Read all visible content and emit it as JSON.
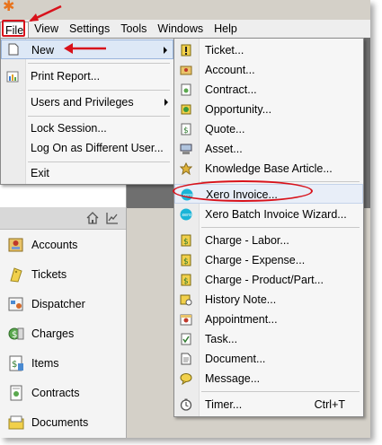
{
  "menubar": {
    "items": [
      "File",
      "View",
      "Settings",
      "Tools",
      "Windows",
      "Help"
    ]
  },
  "file_menu": {
    "items": [
      {
        "label": "New",
        "icon": "new-document-icon",
        "submenu": true
      },
      {
        "label": "Print Report...",
        "icon": "print-report-icon"
      },
      {
        "label": "Users and Privileges",
        "icon": "",
        "submenu": true
      },
      {
        "label": "Lock Session...",
        "icon": ""
      },
      {
        "label": "Log On as Different User...",
        "icon": ""
      },
      {
        "label": "Exit",
        "icon": ""
      }
    ]
  },
  "new_submenu": {
    "items": [
      {
        "label": "Ticket...",
        "icon": "ticket-icon"
      },
      {
        "label": "Account...",
        "icon": "account-icon"
      },
      {
        "label": "Contract...",
        "icon": "contract-icon"
      },
      {
        "label": "Opportunity...",
        "icon": "opportunity-icon"
      },
      {
        "label": "Quote...",
        "icon": "quote-icon"
      },
      {
        "label": "Asset...",
        "icon": "asset-icon"
      },
      {
        "label": "Knowledge Base Article...",
        "icon": "knowledge-base-icon"
      },
      {
        "label": "Xero Invoice...",
        "icon": "xero-icon"
      },
      {
        "label": "Xero Batch Invoice Wizard...",
        "icon": "xero-icon"
      },
      {
        "label": "Charge - Labor...",
        "icon": "charge-icon"
      },
      {
        "label": "Charge - Expense...",
        "icon": "charge-icon"
      },
      {
        "label": "Charge - Product/Part...",
        "icon": "charge-icon"
      },
      {
        "label": "History Note...",
        "icon": "history-note-icon"
      },
      {
        "label": "Appointment...",
        "icon": "appointment-icon"
      },
      {
        "label": "Task...",
        "icon": "task-icon"
      },
      {
        "label": "Document...",
        "icon": "document-icon"
      },
      {
        "label": "Message...",
        "icon": "message-icon"
      },
      {
        "label": "Timer...",
        "icon": "timer-icon",
        "shortcut": "Ctrl+T"
      }
    ]
  },
  "nav_panel": {
    "items": [
      {
        "label": "Accounts",
        "icon": "accounts-icon"
      },
      {
        "label": "Tickets",
        "icon": "tickets-icon"
      },
      {
        "label": "Dispatcher",
        "icon": "dispatcher-icon"
      },
      {
        "label": "Charges",
        "icon": "charges-icon"
      },
      {
        "label": "Items",
        "icon": "items-icon"
      },
      {
        "label": "Contracts",
        "icon": "contracts-icon"
      },
      {
        "label": "Documents",
        "icon": "documents-icon"
      }
    ]
  },
  "colors": {
    "annotation_red": "#d8121b",
    "selection_blue": "#dde8f6",
    "xero_blue": "#1ab4d7"
  }
}
